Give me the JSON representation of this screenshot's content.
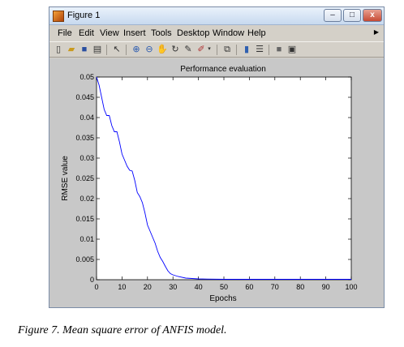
{
  "window": {
    "title": "Figure 1",
    "controls": {
      "minimize": "–",
      "maximize": "□",
      "close": "x"
    }
  },
  "menu": {
    "items": [
      {
        "name": "file",
        "label": "File"
      },
      {
        "name": "edit",
        "label": "Edit"
      },
      {
        "name": "view",
        "label": "View"
      },
      {
        "name": "insert",
        "label": "Insert"
      },
      {
        "name": "tools",
        "label": "Tools"
      },
      {
        "name": "desktop",
        "label": "Desktop"
      },
      {
        "name": "window",
        "label": "Window"
      },
      {
        "name": "help",
        "label": "Help"
      }
    ]
  },
  "toolbar": {
    "icons": [
      "new-file-icon",
      "open-folder-icon",
      "save-icon",
      "print-icon",
      "pointer-icon",
      "zoom-in-icon",
      "zoom-out-icon",
      "pan-hand-icon",
      "rotate-3d-icon",
      "data-cursor-icon",
      "brush-icon",
      "brush-dropdown-icon",
      "link-icon",
      "colorbar-icon",
      "legend-icon",
      "hide-plot-tools-icon",
      "show-plot-tools-icon"
    ]
  },
  "chart_data": {
    "type": "line",
    "title": "Performance evaluation",
    "xlabel": "Epochs",
    "ylabel": "RMSE value",
    "xlim": [
      0,
      100
    ],
    "ylim": [
      0,
      0.05
    ],
    "xticks": [
      "0",
      "10",
      "20",
      "30",
      "40",
      "50",
      "60",
      "70",
      "80",
      "90",
      "100"
    ],
    "yticks": [
      "0",
      "0.005",
      "0.01",
      "0.015",
      "0.02",
      "0.025",
      "0.03",
      "0.035",
      "0.04",
      "0.045",
      "0.05"
    ],
    "grid": false,
    "series_color": "#0000ff",
    "x": [
      0,
      1,
      2,
      3,
      4,
      5,
      6,
      7,
      8,
      9,
      10,
      11,
      12,
      13,
      14,
      15,
      16,
      17,
      18,
      19,
      20,
      21,
      22,
      23,
      24,
      25,
      26,
      27,
      28,
      29,
      30,
      32,
      35,
      40,
      50,
      60,
      70,
      80,
      90,
      100
    ],
    "y": [
      0.05,
      0.048,
      0.045,
      0.042,
      0.0405,
      0.0405,
      0.038,
      0.0365,
      0.0365,
      0.034,
      0.031,
      0.0295,
      0.028,
      0.027,
      0.0268,
      0.0245,
      0.0215,
      0.0205,
      0.019,
      0.0165,
      0.0135,
      0.012,
      0.0105,
      0.009,
      0.007,
      0.0055,
      0.0045,
      0.0033,
      0.0022,
      0.0015,
      0.0012,
      0.0008,
      0.0004,
      0.0002,
      0.0001,
      0.0001,
      0.0001,
      0.0001,
      0.0001,
      0.0001
    ]
  },
  "caption": "Figure 7. Mean square error of ANFIS model."
}
